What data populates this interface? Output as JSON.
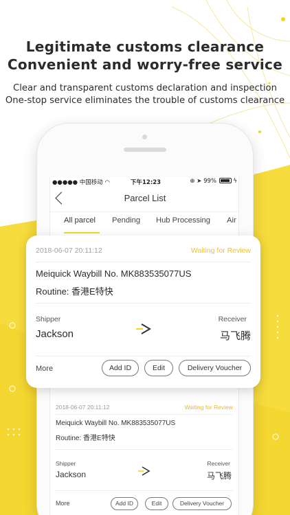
{
  "colors": {
    "accent": "#f4d51e",
    "status_text": "#f0c02e",
    "background_yellow": "#f6dc3c"
  },
  "promo": {
    "headline": [
      "Legitimate  customs clearance",
      "Convenient and worry-free service"
    ],
    "subline": [
      "Clear and transparent customs  declaration and inspection",
      "One-stop service eliminates the trouble of customs clearance"
    ]
  },
  "statusbar": {
    "carrier": "●●●●● 中国移动",
    "time": "下午12:23",
    "battery": "99%",
    "icons": [
      "wifi-icon",
      "lock-rotation-icon",
      "location-icon",
      "charging-icon"
    ]
  },
  "nav": {
    "title": "Parcel List",
    "back_icon": "chevron-left-icon"
  },
  "tabs": [
    "All parcel",
    "Pending",
    "Hub Processing",
    "Air"
  ],
  "active_tab": "All parcel",
  "parcels": [
    {
      "date": "2018-06-07 20:11:12",
      "status": "Waiting for Review",
      "waybill": "Meiquick Waybill No. MK883535077US",
      "routine": "Routine: 香港E特快",
      "shipper_label": "Shipper",
      "shipper": "Jackson",
      "receiver_label": "Receiver",
      "receiver": "马飞腾",
      "more": "More",
      "buttons": [
        "Add ID",
        "Edit",
        "Delivery Voucher"
      ]
    },
    {
      "date": "2018-06-07 20:11:12",
      "status": "Waiting for Review",
      "waybill": "Meiquick Waybill No. MK883535077US",
      "routine": "Routine: 香港E特快",
      "shipper_label": "Shipper",
      "shipper": "Jackson",
      "receiver_label": "Receiver",
      "receiver": "马飞腾",
      "more": "More",
      "buttons": [
        "Add ID",
        "Edit",
        "Delivery Voucher"
      ]
    }
  ]
}
